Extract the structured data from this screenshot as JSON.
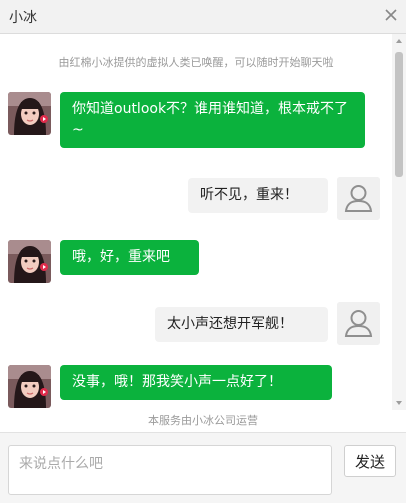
{
  "window": {
    "title": "小冰",
    "close_icon": "close-icon"
  },
  "chat": {
    "notice": "由红棉小冰提供的虚拟人类已唤醒，可以随时开始聊天啦",
    "messages": [
      {
        "sender": "bot",
        "text": "你知道outlook不？谁用谁知道，根本戒不了~"
      },
      {
        "sender": "user",
        "text": "听不见，重来！"
      },
      {
        "sender": "bot",
        "text": "哦，好，重来吧"
      },
      {
        "sender": "user",
        "text": "太小声还想开军舰！"
      },
      {
        "sender": "bot",
        "text": "没事，哦！那我笑小声一点好了！"
      }
    ]
  },
  "footer": {
    "text": "本服务由小冰公司运营"
  },
  "composer": {
    "placeholder": "来说点什么吧",
    "value": "",
    "send_label": "发送"
  },
  "colors": {
    "bot_bubble": "#0bb23d",
    "user_bubble": "#f2f2f2",
    "header_bg": "#f2f2f2"
  }
}
